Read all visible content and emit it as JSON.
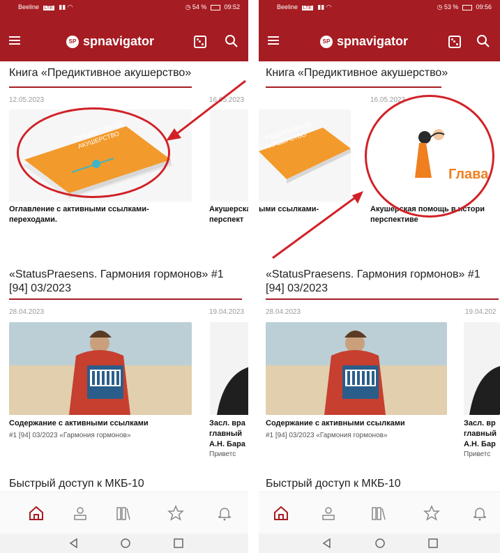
{
  "left": {
    "status": {
      "carrier": "Beeline",
      "net": "LTE",
      "battery": "54 %",
      "time": "09:52"
    },
    "app": {
      "brand": "spnavigator",
      "logo": "SP"
    },
    "section1": {
      "title": "Книга «Предиктивное акушерство»",
      "date1": "12.05.2023",
      "date2": "16.05.2023",
      "card1_title": "Оглавление с активными ссылками-переходами.",
      "card2_title": "Акушерская перспект"
    },
    "section2": {
      "title": "«StatusPraesens. Гармония гормонов» #1 [94] 03/2023",
      "date1": "28.04.2023",
      "date2": "19.04.2023",
      "card1_title": "Содержание с активными ссылками",
      "card1_sub": "#1 [94] 03/2023 «Гармония гормонов»",
      "card2_title": "Засл. вра главный А.Н. Бара",
      "card2_sub": "Приветс"
    },
    "section3": {
      "title": "Быстрый доступ к МКБ-10"
    }
  },
  "right": {
    "status": {
      "carrier": "Beeline",
      "net": "LTE",
      "battery": "53 %",
      "time": "09:56"
    },
    "app": {
      "brand": "spnavigator",
      "logo": "SP"
    },
    "section1": {
      "title": "Книга «Предиктивное акушерство»",
      "date2": "16.05.2023",
      "card1_title": "ыми ссылками-",
      "card2_title": "Акушерская помощь в истори перспективе",
      "glava": "Глава"
    },
    "section2": {
      "title": "«StatusPraesens. Гармония гормонов» #1 [94] 03/2023",
      "date1": "28.04.2023",
      "date2": "19.04.202",
      "card1_title": "Содержание с активными ссылками",
      "card1_sub": "#1 [94] 03/2023 «Гармония гормонов»",
      "card2_title": "Засл. вр главный А.Н. Бар",
      "card2_sub": "Приветс"
    },
    "section3": {
      "title": "Быстрый доступ к МКБ-10"
    }
  },
  "colors": {
    "brand": "#a51c22",
    "annotation": "#d12127",
    "book": "#f39a2c"
  },
  "icons": [
    "home-icon",
    "profile-icon",
    "library-icon",
    "star-icon",
    "bell-icon",
    "back-icon",
    "home-circle-icon",
    "recent-apps-icon",
    "menu-icon",
    "dice-icon",
    "search-icon"
  ]
}
